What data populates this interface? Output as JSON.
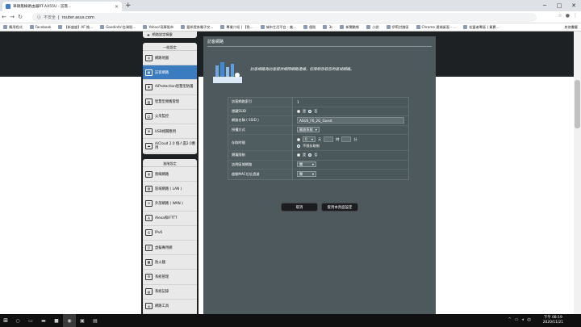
{
  "browser": {
    "tab_title": "華碩無線路由器RT-AX55U - 訪客...",
    "new_tab": "+",
    "address": {
      "security": "不安全",
      "url": "router.asus.com"
    },
    "bookmarks": [
      "應用程式",
      "Facebook",
      "【新盛盛】AF 推...",
      "Goodinfo!台灣股...",
      "Yahoo!奇摩股市",
      "富邦證券電子交...",
      "專業介紹 | 【我...",
      "城市生活平台 - 美...",
      "個股",
      "3c",
      "新聞動態",
      "小說",
      "伊莉討論區",
      "Chrome 遠端桌面 - ...",
      "松盟者專區 | 買賣..."
    ],
    "other_bookmarks": "其他書籤"
  },
  "sidebar": {
    "top_item": "網路設定精靈",
    "general_header": "一般設定",
    "general_items": [
      "網路地圖",
      "訪客網路",
      "AiProtection智慧型防護",
      "智慧型頻寬管理",
      "父母監控",
      "USB相關應用",
      "AiCloud 2.0 個人雲2.0應用"
    ],
    "advanced_header": "進階設定",
    "advanced_items": [
      "無線網路",
      "區域網路 ( LAN )",
      "外部網路 ( WAN )",
      "Alexa和IFTTT",
      "IPv6",
      "虛擬專用網",
      "防火牆",
      "系統管理",
      "系統記錄",
      "網路工具"
    ]
  },
  "main": {
    "title": "訪客網路",
    "description": "訪客網路為訪客提供網際網路連線，但限制存取您的區域網路。",
    "fields": {
      "index_label": "訪客網路索引",
      "index_value": "1",
      "hide_ssid_label": "隱藏SSID",
      "yes": "是",
      "no": "否",
      "ssid_label": "網路名稱 ( SSID )",
      "ssid_value": "ASUS_F6_2G_Guest",
      "auth_label": "授權方式",
      "auth_value": "開放系統",
      "access_time_label": "存取時間",
      "days": "天",
      "hours": "時",
      "minutes": "分",
      "days_value": "0",
      "unlimited": "不限存取制",
      "bandwidth_label": "頻寬限制",
      "intranet_label": "訪問區域網路",
      "intranet_value": "關",
      "mac_filter_label": "啟動MAC位址過濾",
      "mac_filter_value": "關"
    },
    "cancel_button": "取消",
    "apply_button": "套用本頁面設定"
  },
  "taskbar": {
    "time": "下午 08:19",
    "date": "2020/11/21"
  }
}
